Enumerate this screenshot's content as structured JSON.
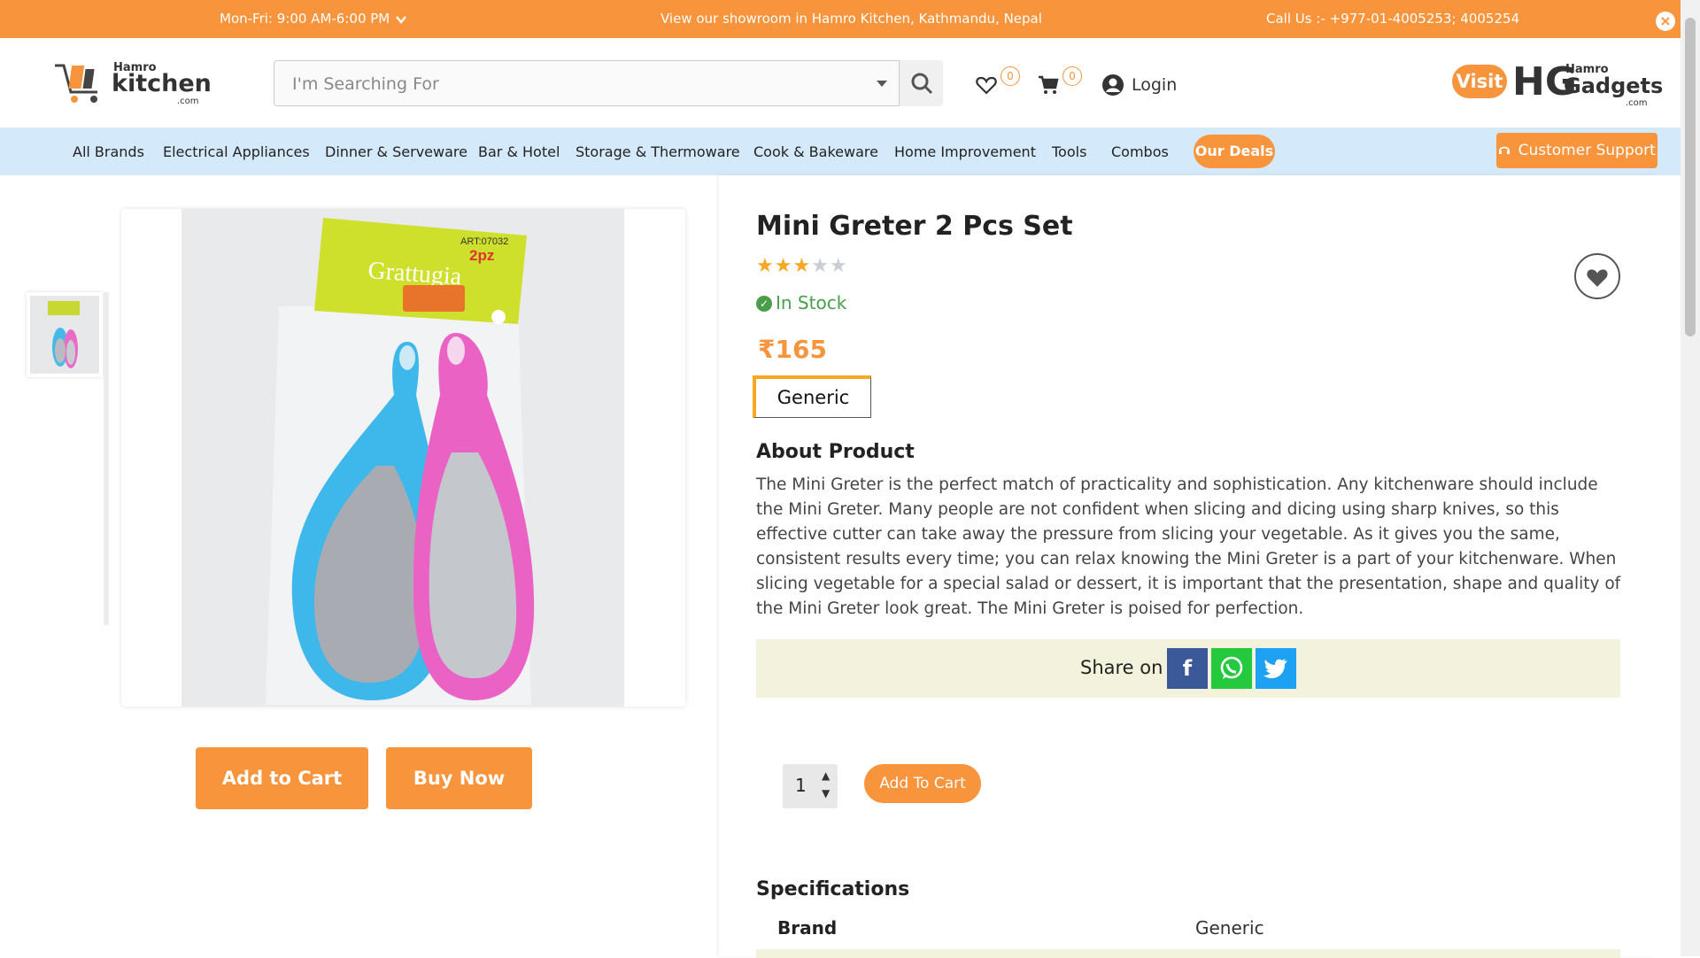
{
  "topbar": {
    "hours": "Mon-Fri: 9:00 AM-6:00 PM",
    "showroom": "View our showroom in Hamro Kitchen, Kathmandu, Nepal",
    "call": "Call Us :- +977-01-4005253; 4005254",
    "close_icon": "close-icon"
  },
  "header": {
    "logo": {
      "hamro": "Hamro",
      "kitchen": "kitchen",
      "dotcom": ".com"
    },
    "search": {
      "placeholder": "I'm Searching For"
    },
    "wishlist_count": "0",
    "cart_count": "0",
    "login": "Login",
    "visit": "Visit",
    "partner": {
      "hamro": "Hamro",
      "name": "Gadgets",
      "dotcom": ".com",
      "glyph": "HG"
    }
  },
  "nav": {
    "items": [
      "All Brands",
      "Electrical Appliances",
      "Dinner & Serveware",
      "Bar & Hotel",
      "Storage & Thermoware",
      "Cook & Bakeware",
      "Home Improvement",
      "Tools",
      "Combos"
    ],
    "deals": "Our Deals",
    "support": "Customer Support"
  },
  "product": {
    "title": "Mini Greter 2 Pcs Set",
    "rating": 3,
    "rating_max": 5,
    "stock": "In Stock",
    "currency": "₹",
    "price": "165",
    "brand_chip": "Generic",
    "image_labels": {
      "art": "ART:07032",
      "count": "2pz",
      "name": "Grattugia"
    },
    "buttons": {
      "add_to_cart": "Add to Cart",
      "buy_now": "Buy Now"
    }
  },
  "about": {
    "heading": "About Product",
    "text": "The Mini Greter is the perfect match of practicality and sophistication. Any kitchenware should include the Mini Greter. Many people are not confident when slicing and dicing using sharp knives, so this effective cutter can take away the pressure from slicing your vegetable. As it gives you the same, consistent results every time; you can relax knowing the Mini Greter is a part of your kitchenware. When slicing vegetable for a special salad or dessert, it is important that the presentation, shape and quality of the Mini Greter look great. The Mini Greter is poised for perfection."
  },
  "share": {
    "label": "Share on",
    "facebook": "f"
  },
  "purchase": {
    "quantity": "1",
    "add_to_cart": "Add To Cart"
  },
  "specifications": {
    "heading": "Specifications",
    "rows": [
      {
        "key": "Brand",
        "value": "Generic"
      }
    ]
  },
  "colors": {
    "accent": "#f7943c",
    "nav_bg": "#d4e9fa",
    "stock_green": "#4a9e4a",
    "share_bg": "#f3f2dd",
    "facebook": "#3b5998",
    "whatsapp": "#25c93e",
    "twitter": "#1da1f2"
  }
}
